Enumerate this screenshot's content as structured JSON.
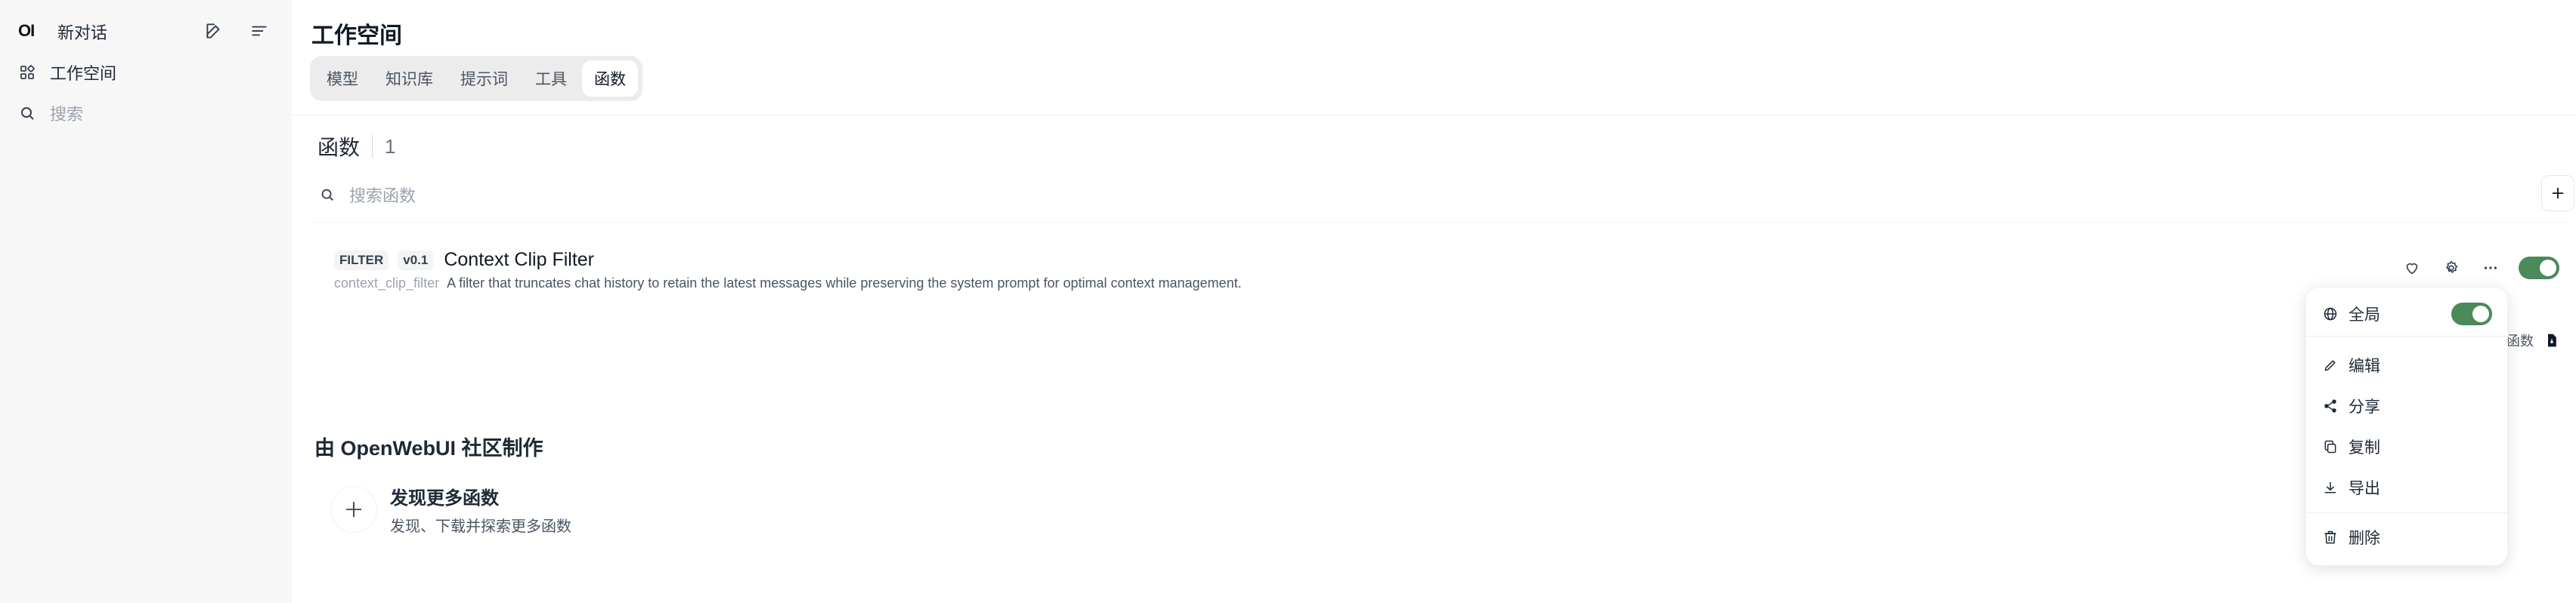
{
  "sidebar": {
    "logo": "OI",
    "new_chat": "新对话",
    "workspace": "工作空间",
    "search_placeholder": "搜索"
  },
  "header": {
    "title": "工作空间",
    "tabs": [
      {
        "label": "模型",
        "active": false
      },
      {
        "label": "知识库",
        "active": false
      },
      {
        "label": "提示词",
        "active": false
      },
      {
        "label": "工具",
        "active": false
      },
      {
        "label": "函数",
        "active": true
      }
    ]
  },
  "functions": {
    "title": "函数",
    "count": "1",
    "search_placeholder": "搜索函数",
    "items": [
      {
        "type_badge": "FILTER",
        "version_badge": "v0.1",
        "name": "Context Clip Filter",
        "id": "context_clip_filter",
        "description": "A filter that truncates chat history to retain the latest messages while preserving the system prompt for optimal context management.",
        "enabled": true
      }
    ],
    "peek_text": "函数"
  },
  "community": {
    "title": "由 OpenWebUI 社区制作",
    "discover_title": "发现更多函数",
    "discover_subtitle": "发现、下载并探索更多函数"
  },
  "menu": {
    "global": "全局",
    "global_enabled": true,
    "edit": "编辑",
    "share": "分享",
    "copy": "复制",
    "export": "导出",
    "delete": "删除"
  },
  "colors": {
    "toggle_on": "#4a8a5b",
    "sidebar_bg": "#f7f7f7"
  }
}
